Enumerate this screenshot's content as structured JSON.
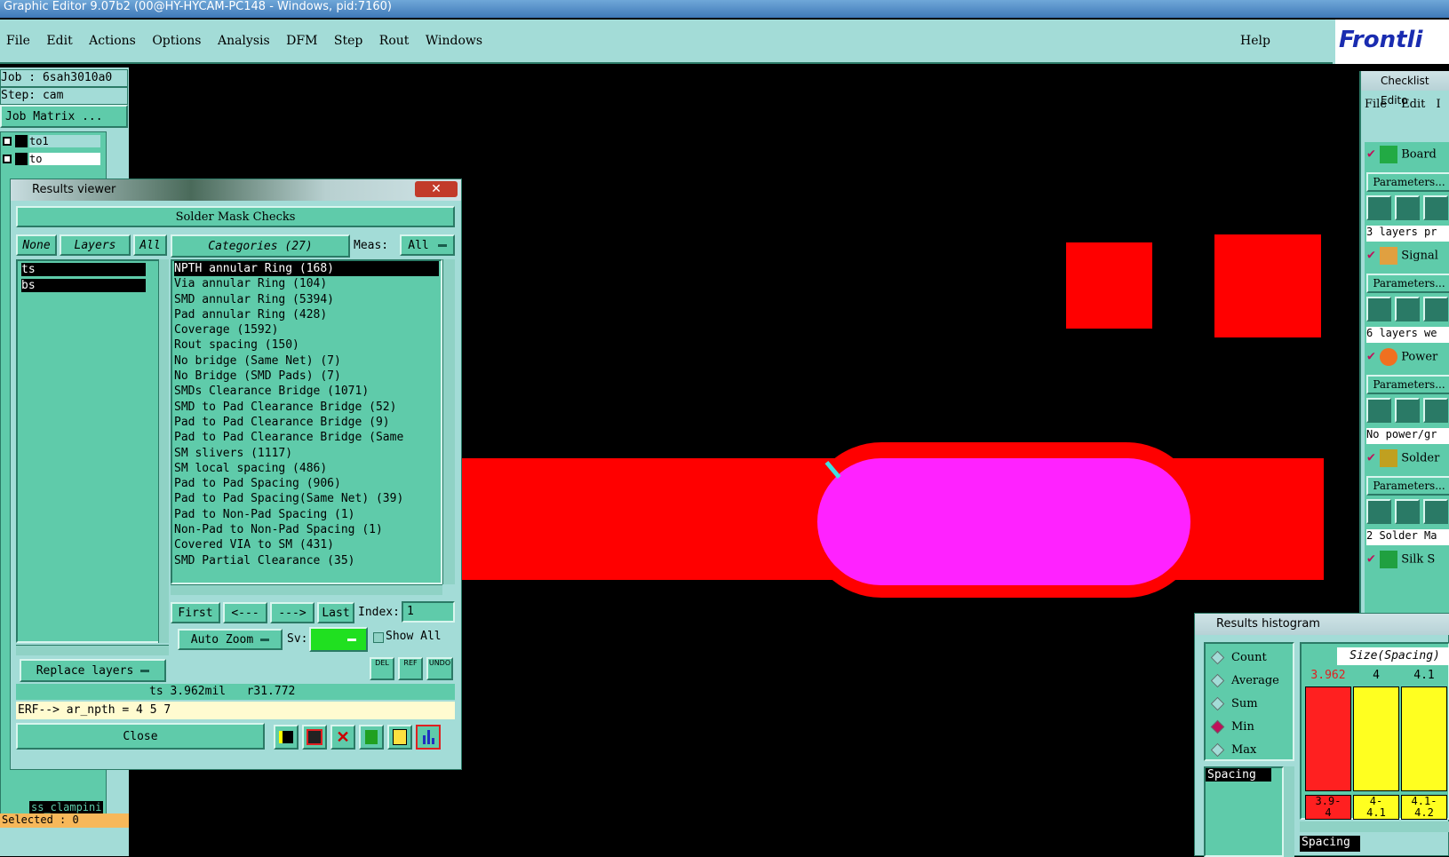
{
  "titlebar": {
    "text": "Graphic Editor 9.07b2 (00@HY-HYCAM-PC148 - Windows, pid:7160)"
  },
  "menubar": {
    "items": [
      "File",
      "Edit",
      "Actions",
      "Options",
      "Analysis",
      "DFM",
      "Step",
      "Rout",
      "Windows"
    ],
    "help": "Help",
    "logo": "Frontli"
  },
  "job_panel": {
    "job": "Job :  6sah3010a0",
    "step": "Step: cam",
    "job_matrix": "Job Matrix ...",
    "layers": [
      "to1",
      "to"
    ],
    "bottom_layer": "ss_clampini",
    "selected": "Selected : 0"
  },
  "results_viewer": {
    "title": "Results viewer",
    "header": "Solder Mask Checks",
    "none_btn": "None",
    "layers_btn": "Layers",
    "all_btn": "All",
    "categories_btn": "Categories (27)",
    "meas_label": "Meas:",
    "meas_value": "All",
    "layers": [
      "ts",
      "bs"
    ],
    "categories": [
      "NPTH annular Ring (168)",
      "Via annular Ring (104)",
      "SMD annular Ring (5394)",
      "Pad annular Ring (428)",
      "Coverage (1592)",
      "Rout spacing (150)",
      "No bridge (Same Net) (7)",
      "No Bridge (SMD Pads) (7)",
      "SMDs Clearance Bridge (1071)",
      "SMD to Pad Clearance Bridge (52)",
      "Pad to Pad Clearance Bridge (9)",
      "Pad to Pad Clearance Bridge (Same",
      "SM slivers (1117)",
      "SM local spacing (486)",
      "Pad to Pad Spacing (906)",
      "Pad to Pad Spacing(Same Net) (39)",
      "Pad to Non-Pad Spacing (1)",
      "Non-Pad to Non-Pad Spacing (1)",
      "Covered VIA to SM (431)",
      "SMD Partial Clearance (35)"
    ],
    "nav": {
      "first": "First",
      "prev": "<---",
      "next": "--->",
      "last": "Last",
      "index_label": "Index:",
      "index_value": "1"
    },
    "auto_zoom": "Auto Zoom",
    "sv_label": "Sv:",
    "show_all": "Show All",
    "replace_layers": "Replace layers",
    "small_btns": [
      "DEL",
      "REF",
      "UNDO"
    ],
    "status": "ts 3.962mil   r31.772",
    "erf": "ERF--> ar_npth = 4 5 7",
    "close": "Close"
  },
  "checklist": {
    "title": "Checklist Edito",
    "menu": [
      "File",
      "Edit",
      "I"
    ],
    "rows": [
      {
        "label": "Board",
        "params": "Parameters...",
        "info": "3 layers pr"
      },
      {
        "label": "Signal",
        "params": "Parameters...",
        "info": "6 layers we"
      },
      {
        "label": "Power",
        "params": "Parameters...",
        "info": "No power/gr"
      },
      {
        "label": "Solder",
        "params": "Parameters...",
        "info": "2 Solder Ma"
      },
      {
        "label": "Silk S",
        "params": "",
        "info": ""
      }
    ]
  },
  "histogram": {
    "title": "Results histogram",
    "options": [
      "Count",
      "Average",
      "Sum",
      "Min",
      "Max"
    ],
    "selected": "Min",
    "list_item": "Spacing",
    "chart_title": "Size(Spacing)",
    "bars": [
      {
        "value": "3.962",
        "range": "3.9-\n4",
        "color": "#ff2020"
      },
      {
        "value": "4",
        "range": "4-\n4.1",
        "color": "#ffff20"
      },
      {
        "value": "4.1",
        "range": "4.1-\n4.2",
        "color": "#ffff20"
      }
    ],
    "bottom_label": "Spacing"
  },
  "colors": {
    "canvas": "#000000",
    "copper": "#ff0000",
    "pad": "#ff22ff",
    "ui": "#5fcbaa",
    "ui_pale": "#a3dcd7"
  }
}
